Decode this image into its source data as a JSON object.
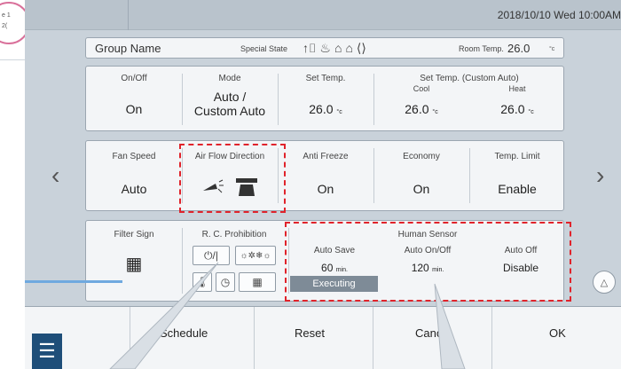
{
  "status_bar": {
    "datetime": "2018/10/10 Wed 10:00AM"
  },
  "background_fragment": {
    "line1": "e 1",
    "line2": "2("
  },
  "header": {
    "group_name": "Group Name",
    "special_state_label": "Special State",
    "special_state_icons": [
      "↑⌷",
      "♨",
      "⌂",
      "⌂",
      "⟨⟩"
    ],
    "room_temp_label": "Room Temp.",
    "room_temp_value": "26.0",
    "room_temp_unit": "°c"
  },
  "row1": {
    "onoff": {
      "label": "On/Off",
      "value": "On"
    },
    "mode": {
      "label": "Mode",
      "value_line1": "Auto /",
      "value_line2": "Custom Auto"
    },
    "set_temp": {
      "label": "Set Temp.",
      "value": "26.0",
      "unit": "°c"
    },
    "custom_auto": {
      "label": "Set Temp. (Custom Auto)",
      "cool_label": "Cool",
      "cool_value": "26.0",
      "heat_label": "Heat",
      "heat_value": "26.0",
      "unit": "°c"
    }
  },
  "row2": {
    "fan_speed": {
      "label": "Fan Speed",
      "value": "Auto"
    },
    "air_flow": {
      "label": "Air Flow Direction"
    },
    "anti_freeze": {
      "label": "Anti Freeze",
      "value": "On"
    },
    "economy": {
      "label": "Economy",
      "value": "On"
    },
    "temp_limit": {
      "label": "Temp. Limit",
      "value": "Enable"
    }
  },
  "row3": {
    "filter_sign": {
      "label": "Filter Sign"
    },
    "rc_prohibition": {
      "label": "R. C. Prohibition",
      "btn_onoff": "⏻/|",
      "btn_mode": "☼✲❄☼"
    },
    "human_sensor": {
      "label": "Human Sensor",
      "auto_save_label": "Auto Save",
      "auto_save_value": "60",
      "auto_save_unit": "min.",
      "auto_onoff_label": "Auto On/Off",
      "auto_onoff_value": "120",
      "auto_onoff_unit": "min.",
      "auto_off_label": "Auto Off",
      "auto_off_value": "Disable",
      "status": "Executing"
    }
  },
  "footer": {
    "schedule": "Schedule",
    "reset": "Reset",
    "cancel": "Cancel",
    "ok": "OK"
  },
  "icons": {
    "prev": "‹",
    "next": "›",
    "menu": "☰",
    "up": "△",
    "thermometer": "🌡",
    "clock": "◷",
    "filter": "▦"
  },
  "colors": {
    "highlight": "#e0232b",
    "menu_button": "#1e4e79",
    "progress": "#6fa9df",
    "executing": "#7e8b97"
  }
}
